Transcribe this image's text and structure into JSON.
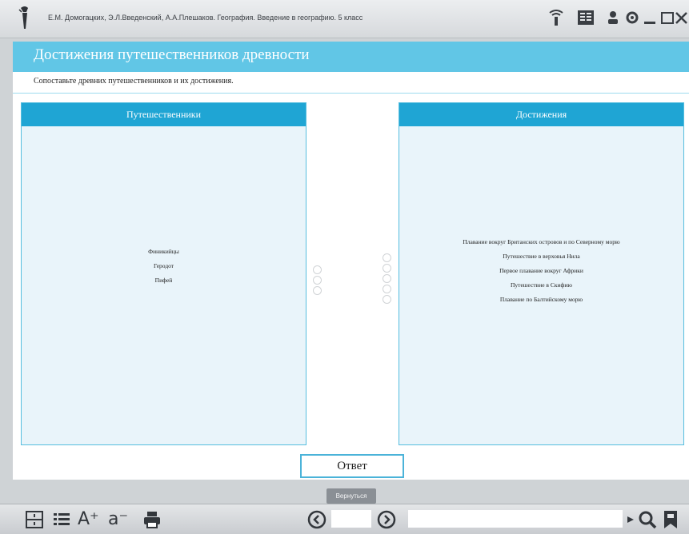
{
  "window": {
    "title": "Е.М. Домогацких, Э.Л.Введенский, А.А.Плешаков. География. Введение в географию. 5 класс"
  },
  "icons": {
    "app": "torch-icon",
    "toolbar_top": [
      "hand-antenna-icon",
      "book-icon",
      "user-icon",
      "gear-icon",
      "minimize-icon",
      "maximize-icon",
      "close-icon"
    ],
    "toolbar_bottom": [
      "fit-page-icon",
      "list-icon",
      "font-increase-icon",
      "font-decrease-icon",
      "print-icon",
      "prev-page-icon",
      "next-page-icon",
      "play-icon",
      "search-icon",
      "bookmark-icon"
    ]
  },
  "exercise": {
    "title": "Достижения путешественников древности",
    "instruction": "Сопоставьте древних путешественников и их достижения."
  },
  "left_panel": {
    "heading": "Путешественники",
    "items": [
      "Финикийцы",
      "Геродот",
      "Пифей"
    ]
  },
  "right_panel": {
    "heading": "Достижения",
    "items": [
      "Плавание вокруг Британских островов и по Северному морю",
      "Путешествие в верховья Нила",
      "Первое плавание вокруг Африки",
      "Путешествие в Скифию",
      "Плавание по Балтийскому морю"
    ]
  },
  "buttons": {
    "answer": "Ответ",
    "return": "Вернуться"
  },
  "toolbar": {
    "font_increase": "A⁺",
    "font_decrease": "a⁻",
    "page_value": "",
    "search_value": ""
  },
  "colors": {
    "accent": "#1fa5d4",
    "header": "#61c6e6",
    "panel_bg": "#e9f4fa"
  }
}
